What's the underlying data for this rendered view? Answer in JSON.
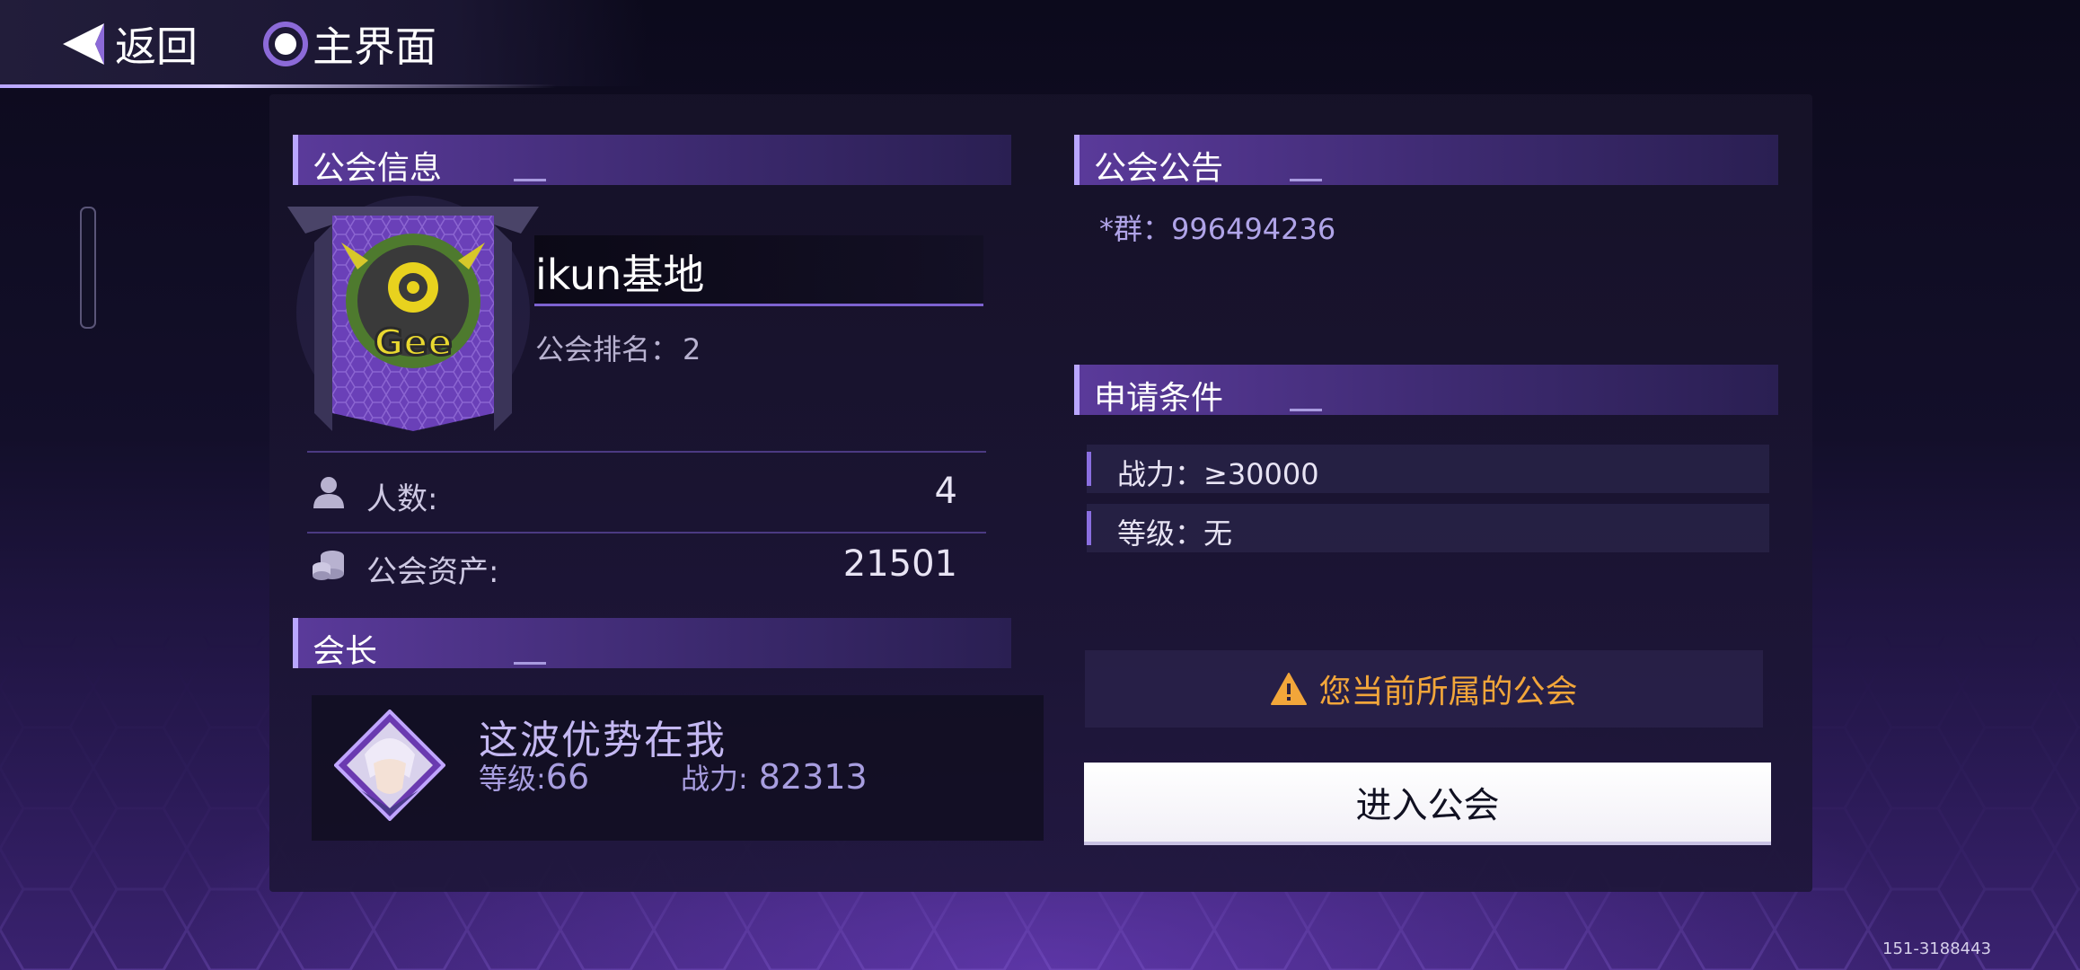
{
  "topbar": {
    "back_label": "返回",
    "home_label": "主界面"
  },
  "guild_info": {
    "header": "公会信息",
    "emblem_text": "Gee",
    "name": "ikun基地",
    "rank_label": "公会排名：",
    "rank_value": "2",
    "members_label": "人数:",
    "members_value": "4",
    "assets_label": "公会资产:",
    "assets_value": "21501"
  },
  "leader": {
    "header": "会长",
    "name": "这波优势在我",
    "level_label": "等级:",
    "level_value": "66",
    "power_label": "战力:",
    "power_value": "82313"
  },
  "announcement": {
    "header": "公会公告",
    "text": "*群：996494236"
  },
  "requirements": {
    "header": "申请条件",
    "items": [
      {
        "text": "战力：≥30000"
      },
      {
        "text": "等级：无"
      }
    ]
  },
  "current_guild_notice": "您当前所属的公会",
  "enter_button": "进入公会",
  "build_id": "151-3188443",
  "colors": {
    "accent": "#b9a6ff",
    "warning": "#f2a63a",
    "header_purple": "#5a3a9a"
  }
}
